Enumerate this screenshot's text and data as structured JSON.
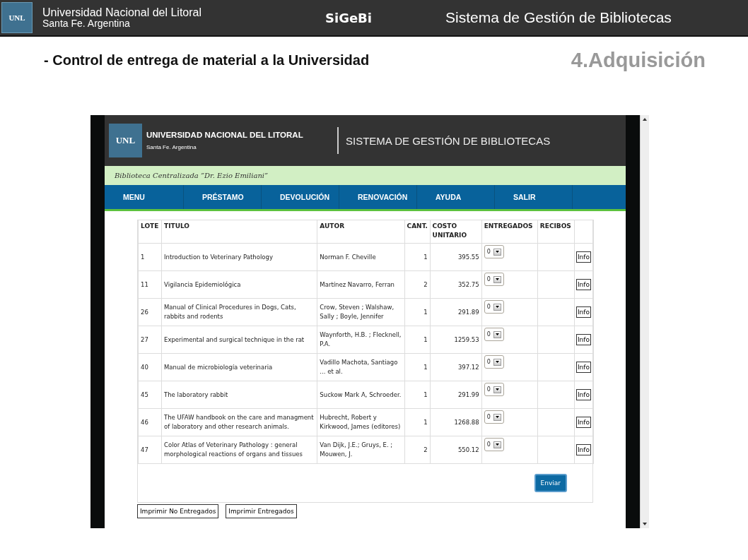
{
  "slide_header": {
    "logo": "UNL",
    "university": "Universidad Nacional del Litoral",
    "city": "Santa Fe. Argentina",
    "acronym": "SiGeBi",
    "system": "Sistema de Gestión de Bibliotecas"
  },
  "slide_title": "- Control de entrega de material a la Universidad",
  "section": "4.Adquisición",
  "app": {
    "logo": "UNL",
    "university": "UNIVERSIDAD NACIONAL DEL LITORAL",
    "city": "Santa Fe. Argentina",
    "system": "SISTEMA DE GESTIÓN DE BIBLIOTECAS",
    "library": "Biblioteca Centralizada ”Dr. Ezio Emiliani”",
    "nav": [
      "MENU",
      "PRÉSTAMO",
      "DEVOLUCIÓN",
      "RENOVACIÓN",
      "AYUDA",
      "SALIR"
    ],
    "table": {
      "columns": [
        "LOTE",
        "TITULO",
        "AUTOR",
        "CANT.",
        "COSTO UNITARIO",
        "ENTREGADOS",
        "RECIBOS"
      ],
      "rows": [
        {
          "lote": "1",
          "titulo": "Introduction to Veterinary Pathology",
          "autor": "Norman F. Cheville",
          "cant": "1",
          "costo": "395.55",
          "entregados": "0",
          "action": "Info"
        },
        {
          "lote": "11",
          "titulo": "Vigilancia Epidemiológica",
          "autor": "Martínez Navarro, Ferran",
          "cant": "2",
          "costo": "352.75",
          "entregados": "0",
          "action": "Info"
        },
        {
          "lote": "26",
          "titulo": "Manual of Clinical Procedures in Dogs, Cats, rabbits and rodents",
          "autor": "Crow, Steven ; Walshaw, Sally ; Boyle, Jennifer",
          "cant": "1",
          "costo": "291.89",
          "entregados": "0",
          "action": "Info"
        },
        {
          "lote": "27",
          "titulo": "Experimental and surgical technique in the rat",
          "autor": "Waynforth, H.B. ; Flecknell, P.A.",
          "cant": "1",
          "costo": "1259.53",
          "entregados": "0",
          "action": "Info"
        },
        {
          "lote": "40",
          "titulo": "Manual de microbiología veterinaria",
          "autor": "Vadillo Machota, Santiago ... et al.",
          "cant": "1",
          "costo": "397.12",
          "entregados": "0",
          "action": "Info"
        },
        {
          "lote": "45",
          "titulo": "The laboratory rabbit",
          "autor": "Suckow Mark A, Schroeder.",
          "cant": "1",
          "costo": "291.99",
          "entregados": "0",
          "action": "Info"
        },
        {
          "lote": "46",
          "titulo": "The UFAW handbook on the care and managment of laboratory and other research animals.",
          "autor": "Hubrecht, Robert y Kirkwood, James (editores)",
          "cant": "1",
          "costo": "1268.88",
          "entregados": "0",
          "action": "Info"
        },
        {
          "lote": "47",
          "titulo": "Color Atlas of Veterinary Pathology : general morphological reactions of organs and tissues",
          "autor": "Van Dijk, J.E.; Gruys, E. ; Mouwen, J.",
          "cant": "2",
          "costo": "550.12",
          "entregados": "0",
          "action": "Info"
        }
      ]
    },
    "submit": "Enviar",
    "print_buttons": [
      "Imprimir No Entregados",
      "Imprimir Entregados"
    ]
  }
}
